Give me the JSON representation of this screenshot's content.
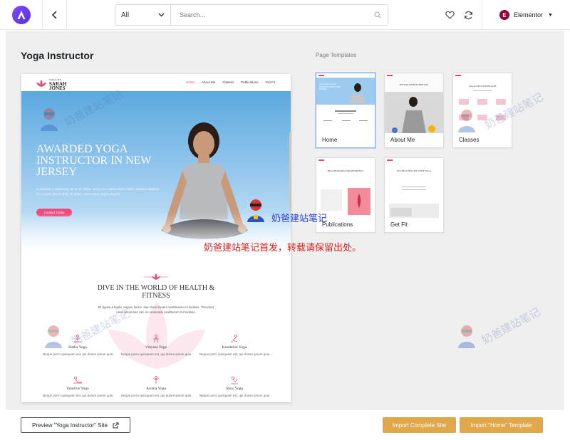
{
  "toolbar": {
    "category_value": "All",
    "search_placeholder": "Search...",
    "builder_label": "Elementor",
    "builder_badge": "E"
  },
  "site": {
    "title": "Yoga Instructor",
    "page_templates_label": "Page Templates"
  },
  "preview": {
    "logo_small": "YOGA BY",
    "logo_line1": "SARAH",
    "logo_line2": "JONES",
    "menu": [
      "Home",
      "About Me",
      "Classes",
      "Publications",
      "Get Fit"
    ],
    "hero_title": "AWARDED YOGA INSTRUCTOR IN NEW JERSEY",
    "hero_text": "Consectetur adipiscing elit ut elit tellus, luctus nec ullamcorper mattis, pulvinar dapibus leo. Lorem ipsum dolor sit amet, consectetur adipiscing elit.",
    "hero_button": "Contact Today",
    "section_title": "DIVE IN THE WORLD OF HEALTH & FITNESS",
    "section_sub": "Et ligula ut ligula, sapien lorem. Nec risus bovem vestibulum mi facilisis. Tincidunt urna accumsan nec mi venenatis vestibulum mi facilisis.",
    "classes": [
      {
        "name": "Hatha Yoga",
        "desc": "Neque porro quisquam est, qui dolore ipsum quia"
      },
      {
        "name": "Vinyasa Yoga",
        "desc": "Neque porro quisquam est, qui dolore ipsum quia"
      },
      {
        "name": "Kundalini Yoga",
        "desc": "Neque porro quisquam est, qui dolore ipsum quia"
      },
      {
        "name": "Intuitive Yoga",
        "desc": "Neque porro quisquam est, qui dolore ipsum quia"
      },
      {
        "name": "Aroma Yoga",
        "desc": "Neque porro quisquam est, qui dolore ipsum quia"
      },
      {
        "name": "Slow Yoga",
        "desc": "Neque porro quisquam est, qui dolore ipsum quia"
      }
    ]
  },
  "templates": [
    {
      "name": "Home",
      "selected": true
    },
    {
      "name": "About Me",
      "selected": false
    },
    {
      "name": "Classes",
      "selected": false
    },
    {
      "name": "Publications",
      "selected": false
    },
    {
      "name": "Get Fit",
      "selected": false
    }
  ],
  "thumbs": {
    "home_heading": "AWARDED YOGA INSTRUCTOR IN NEW JERSEY",
    "about_heading": "MY WAY OF HEALTHY LIFE",
    "classes_heading": "YOGA FOR YOUR HEALTH",
    "pub_heading": "HEALTH BOOKS FOR REFERENCE",
    "getfit_heading": "GET HEALTHY LIFE WITH YOGA"
  },
  "footer": {
    "preview_button": "Preview \"Yoga Instructor\" Site",
    "import_site_button": "Import Complete Site",
    "import_template_button": "Import \"Home\" Template"
  },
  "watermarks": {
    "site_name": "奶爸建站笔记",
    "notice": "奶爸建站笔记首发，转载请保留出处。"
  },
  "colors": {
    "accent_purple": "#6b3fef",
    "gold": "#e1a84b",
    "pink": "#ee4a7d",
    "elementor": "#92003b"
  }
}
